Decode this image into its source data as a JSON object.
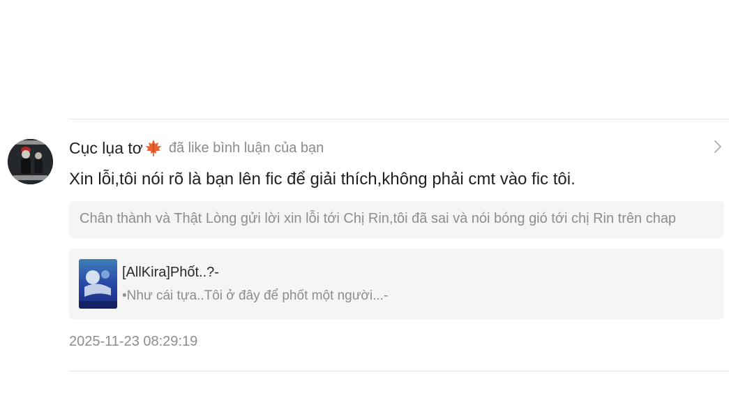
{
  "notification": {
    "username": "Cục lụa tơ",
    "username_emoji_icon": "maple-leaf-icon",
    "action": "đã like bình luận của bạn",
    "comment": "Xin lỗi,tôi nói rõ là bạn lên fic để giải thích,không phải cmt vào fic tôi.",
    "quoted_comment": "Chân thành và Thật Lòng gửi lời xin lỗi tới Chị Rin,tôi đã sai và nói bóng gió tới chị Rin trên chap",
    "story": {
      "title": "[AllKira]Phốt..?-",
      "description": "•Như cái tựa..Tôi ở đây để phốt một người...-"
    },
    "timestamp": "2025-11-23 08:29:19"
  },
  "colors": {
    "username": "#222222",
    "secondary_text": "#8d8d8d",
    "card_background": "#f5f5f5",
    "divider": "#e4e4e4",
    "leaf": "#e8602c"
  }
}
